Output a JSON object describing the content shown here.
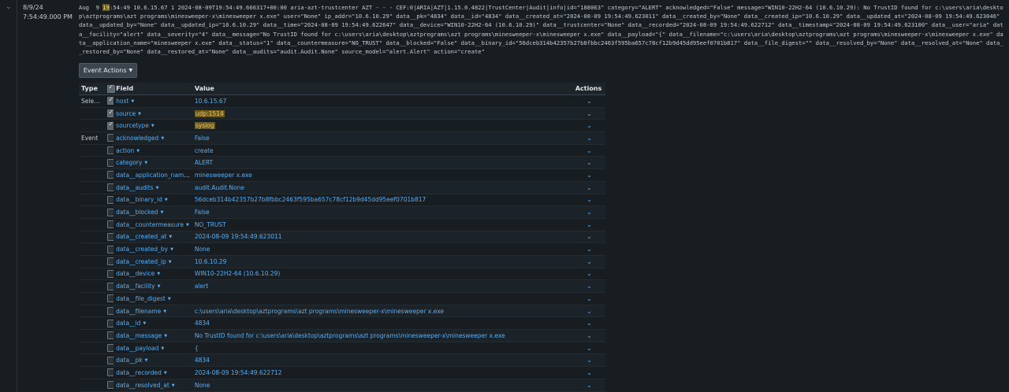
{
  "event": {
    "date": "8/9/24",
    "time": "7:54:49.000 PM",
    "raw_pre": "Aug  9 ",
    "raw_highlight": "19",
    "raw_post": ":54:49 10.6.15.67 1 2024-08-09T19:54:49.666317+00:00 aria-azt-trustcenter AZT - - - CEF:0|ARIA|AZT|1.15.0.4822|TrustCenter|Audit|info|id=\"188063\" category=\"ALERT\" acknowledged=\"False\" message=\"WIN10-22H2-64 (10.6.10.29): No TrustID found for c:\\users\\aria\\desktop\\aztprograms\\azt programs\\minesweeper-x\\minesweeper x.exe\" user=\"None\" ip_addr=\"10.6.10.29\" data__pk=\"4834\" data__id=\"4834\" data__created_at=\"2024-08-09 19:54:49.623011\" data__created_by=\"None\" data__created_ip=\"10.6.10.29\" data__updated_at=\"2024-08-09 19:54:49.623046\" data__updated_by=\"None\" data__updated_ip=\"10.6.10.29\" data__time=\"2024-08-09 19:54:49.622647\" data__device=\"WIN10-22H2-64 (10.6.10.29)\" data__trustcenter=\"None\" data__recorded=\"2024-08-09 19:54:49.622712\" data__timestamp=\"2024-08-09 19:54:49.623100\" data__user=\"aria\" data__facility=\"alert\" data__severity=\"4\" data__message=\"No TrustID found for c:\\users\\aria\\desktop\\aztprograms\\azt programs\\minesweeper-x\\minesweeper x.exe\" data__payload=\"{\" data__filename=\"c:\\users\\aria\\desktop\\aztprograms\\azt programs\\minesweeper-x\\minesweeper x.exe\" data__application_name=\"minesweeper x.exe\" data__status=\"1\" data__countermeasure=\"NO_TRUST\" data__blocked=\"False\" data__binary_id=\"56dceb314b42357b27b8fbbc2463f595ba657c78cf12b9d45dd95eef0701b817\" data__file_digest=\"\" data__resolved_by=\"None\" data__resolved_at=\"None\" data__restored_by=\"None\" data__restored_at=\"None\" data__audits=\"audit.Audit.None\" source_model=\"alert.Alert\" action=\"create\""
  },
  "event_actions_label": "Event Actions",
  "table": {
    "headers": {
      "type": "Type",
      "field": "Field",
      "value": "Value",
      "actions": "Actions"
    },
    "rows": [
      {
        "type": "Selected",
        "checked": true,
        "field": "host",
        "value": "10.6.15.67"
      },
      {
        "type": "",
        "checked": true,
        "field": "source",
        "value": "udp:1514",
        "highlight": true
      },
      {
        "type": "",
        "checked": true,
        "field": "sourcetype",
        "value": "syslog",
        "highlight": true
      },
      {
        "type": "Event",
        "checked": false,
        "field": "acknowledged",
        "value": "False"
      },
      {
        "type": "",
        "checked": false,
        "field": "action",
        "value": "create"
      },
      {
        "type": "",
        "checked": false,
        "field": "category",
        "value": "ALERT"
      },
      {
        "type": "",
        "checked": false,
        "field": "data__application_name",
        "value": "minesweeper x.exe"
      },
      {
        "type": "",
        "checked": false,
        "field": "data__audits",
        "value": "audit.Audit.None"
      },
      {
        "type": "",
        "checked": false,
        "field": "data__binary_id",
        "value": "56dceb314b42357b27b8fbbc2463f595ba657c78cf12b9d45dd95eef0701b817"
      },
      {
        "type": "",
        "checked": false,
        "field": "data__blocked",
        "value": "False"
      },
      {
        "type": "",
        "checked": false,
        "field": "data__countermeasure",
        "value": "NO_TRUST"
      },
      {
        "type": "",
        "checked": false,
        "field": "data__created_at",
        "value": "2024-08-09 19:54:49.623011"
      },
      {
        "type": "",
        "checked": false,
        "field": "data__created_by",
        "value": "None"
      },
      {
        "type": "",
        "checked": false,
        "field": "data__created_ip",
        "value": "10.6.10.29"
      },
      {
        "type": "",
        "checked": false,
        "field": "data__device",
        "value": "WIN10-22H2-64 (10.6.10.29)"
      },
      {
        "type": "",
        "checked": false,
        "field": "data__facility",
        "value": "alert"
      },
      {
        "type": "",
        "checked": false,
        "field": "data__file_digest",
        "value": ""
      },
      {
        "type": "",
        "checked": false,
        "field": "data__filename",
        "value": "c:\\users\\aria\\desktop\\aztprograms\\azt programs\\minesweeper-x\\minesweeper x.exe"
      },
      {
        "type": "",
        "checked": false,
        "field": "data__id",
        "value": "4834"
      },
      {
        "type": "",
        "checked": false,
        "field": "data__message",
        "value": "No TrustID found for c:\\users\\aria\\desktop\\aztprograms\\azt programs\\minesweeper-x\\minesweeper x.exe"
      },
      {
        "type": "",
        "checked": false,
        "field": "data__payload",
        "value": "{"
      },
      {
        "type": "",
        "checked": false,
        "field": "data__pk",
        "value": "4834"
      },
      {
        "type": "",
        "checked": false,
        "field": "data__recorded",
        "value": "2024-08-09 19:54:49.622712"
      },
      {
        "type": "",
        "checked": false,
        "field": "data__resolved_at",
        "value": "None"
      }
    ]
  },
  "icons": {
    "expand": "chevron-down-icon",
    "dropdown": "caret-down-icon",
    "checkbox": "checkbox-icon"
  },
  "colors": {
    "link": "#5aaef4",
    "background": "#171d21",
    "highlight": "#6b5b1a"
  }
}
